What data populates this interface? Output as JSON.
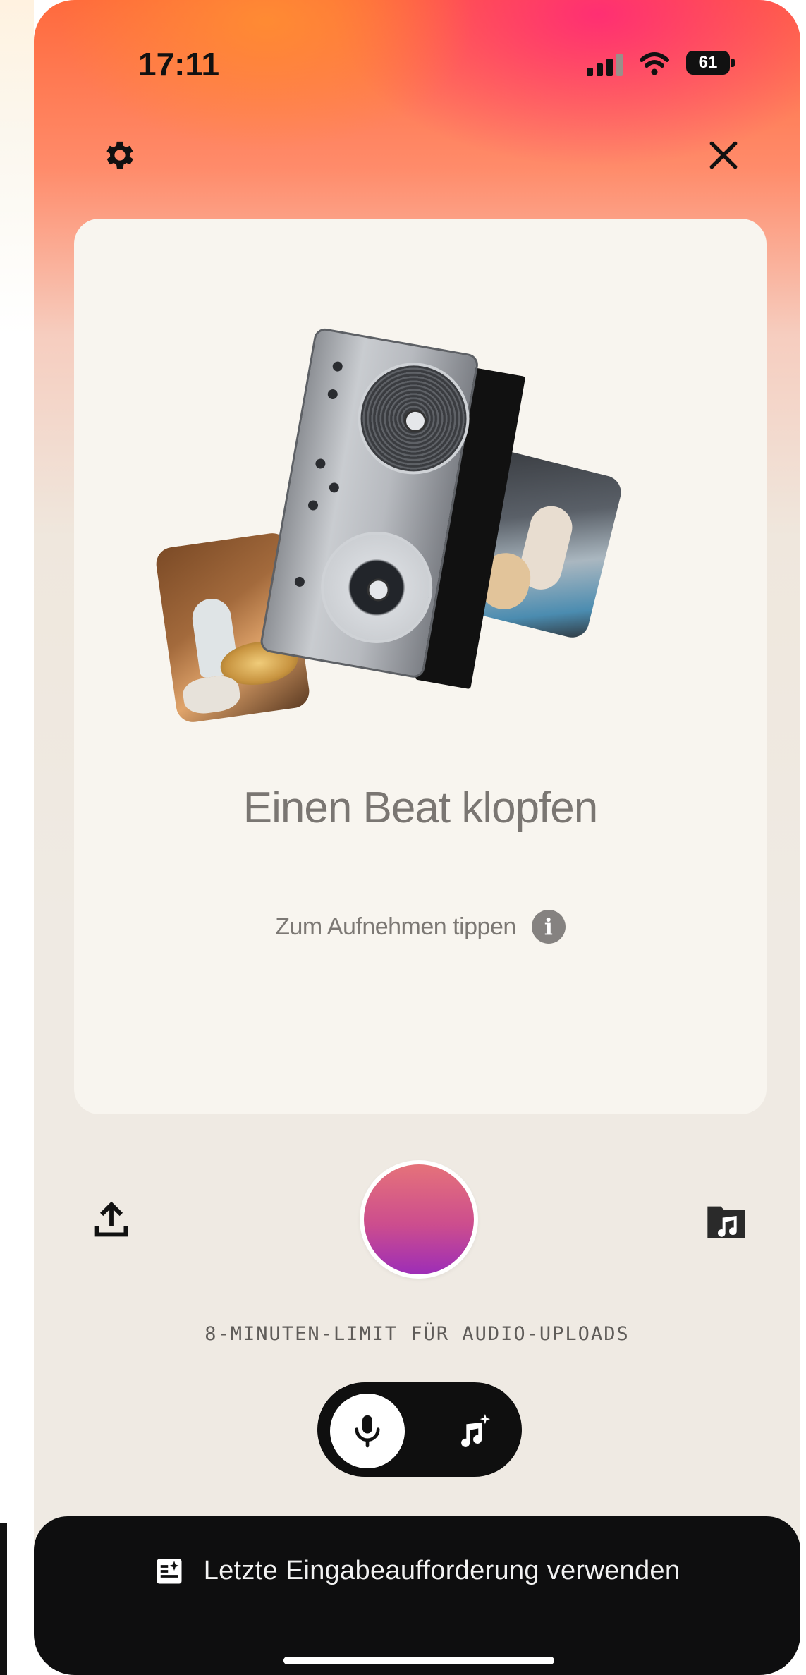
{
  "status_bar": {
    "time": "17:11",
    "battery": "61",
    "icons": [
      "cellular-signal-icon",
      "wifi-icon",
      "battery-icon"
    ]
  },
  "header": {
    "settings_icon": "gear-icon",
    "close_icon": "close-icon"
  },
  "card": {
    "title": "Einen Beat klopfen",
    "hint": "Zum Aufnehmen tippen",
    "info_icon_glyph": "i"
  },
  "controls": {
    "upload_icon": "upload-icon",
    "library_icon": "music-folder-icon",
    "record_gradient": [
      "#e5727a",
      "#cc4d8e",
      "#9d2db7"
    ],
    "limit_text": "8-MINUTEN-LIMIT FÜR AUDIO-UPLOADS"
  },
  "mode_toggle": {
    "selected": "microphone",
    "options": [
      "microphone-icon",
      "music-sparkle-icon"
    ]
  },
  "bottom_bar": {
    "icon": "prompt-sparkle-icon",
    "label": "Letzte Eingabeaufforderung verwenden"
  },
  "colors": {
    "accent_orange": "#ff6a3d",
    "accent_pink": "#ff2878",
    "bottom_bar": "#0e0e0f"
  }
}
